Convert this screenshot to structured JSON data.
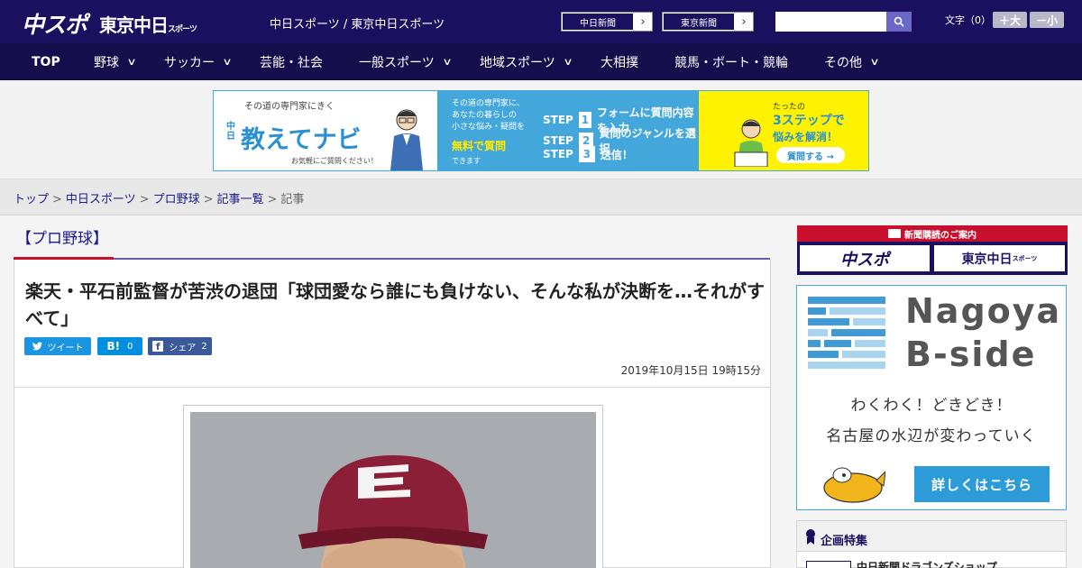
{
  "header": {
    "logo_chuspo": "中スポ",
    "logo_tokyo": "東京中日",
    "logo_tokyo_small": "スポーツ",
    "site_name": "中日スポーツ / 東京中日スポーツ",
    "ext_links": [
      "中日新聞",
      "東京新聞"
    ],
    "search_placeholder": "",
    "fontsize_label": "文字（0）",
    "fontsize_plus": "＋大",
    "fontsize_minus": "－小"
  },
  "nav": [
    {
      "label": "TOP"
    },
    {
      "label": "野球"
    },
    {
      "label": "サッカー"
    },
    {
      "label": "芸能・社会"
    },
    {
      "label": "一般スポーツ"
    },
    {
      "label": "地域スポーツ"
    },
    {
      "label": "大相撲"
    },
    {
      "label": "競馬・ボート・競輪"
    },
    {
      "label": "その他"
    }
  ],
  "banner": {
    "tag": "その道の専門家にきく",
    "chunichi": "中日",
    "title": "教えてナビ",
    "note": "お気軽にご質問ください！",
    "desc_line1": "その道の専門家に、",
    "desc_line2": "あなたの暮らしの",
    "desc_line3": "小さな悩み・疑問を",
    "free": "無料で質問",
    "dekimasu": "できます",
    "steps": [
      {
        "label": "STEP",
        "num": "1",
        "text": "フォームに質問内容を入力"
      },
      {
        "label": "STEP",
        "num": "2",
        "text": "質問のジャンルを選択"
      },
      {
        "label": "STEP",
        "num": "3",
        "text": "送信！"
      }
    ],
    "right_small": "たったの",
    "right_big": "3ステップで",
    "right_big2": "悩みを解消！",
    "question_btn": "質問する →"
  },
  "breadcrumb": {
    "items": [
      "トップ",
      "中日スポーツ",
      "プロ野球",
      "記事一覧"
    ],
    "sep": ">",
    "current": "記事"
  },
  "article": {
    "category": "【プロ野球】",
    "title": "楽天・平石前監督が苦渋の退団「球団愛なら誰にも負けない、そんな私が決断を…それがすべて」",
    "tweet_label": "ツイート",
    "hatena_label": "B!",
    "hatena_count": "0",
    "fb_label": "シェア",
    "fb_count": "2",
    "date": "2019年10月15日 19時15分"
  },
  "sidebar": {
    "subscription_head": "新聞購読のご案内",
    "sub_logo1": "中スポ",
    "sub_logo2": "東京中日",
    "sub_logo2_small": "スポーツ",
    "nagoya_title_1": "Nagoya",
    "nagoya_title_2": "B-side",
    "nagoya_text1": "わくわく！どきどき！",
    "nagoya_text2": "名古屋の水辺が変わっていく",
    "nagoya_button": "詳しくはこちら",
    "feature_title": "企画特集",
    "feature_item": "中日新聞ドラゴンズショップ"
  },
  "colors": {
    "header_bg": "#1a1060",
    "nav_bg": "#140e4c",
    "accent_red": "#c8102e",
    "link": "#1a1a8c",
    "twitter": "#1b95e0",
    "hatena": "#008fde",
    "facebook": "#3b5998",
    "nagoya_blue": "#2d9bd8"
  }
}
